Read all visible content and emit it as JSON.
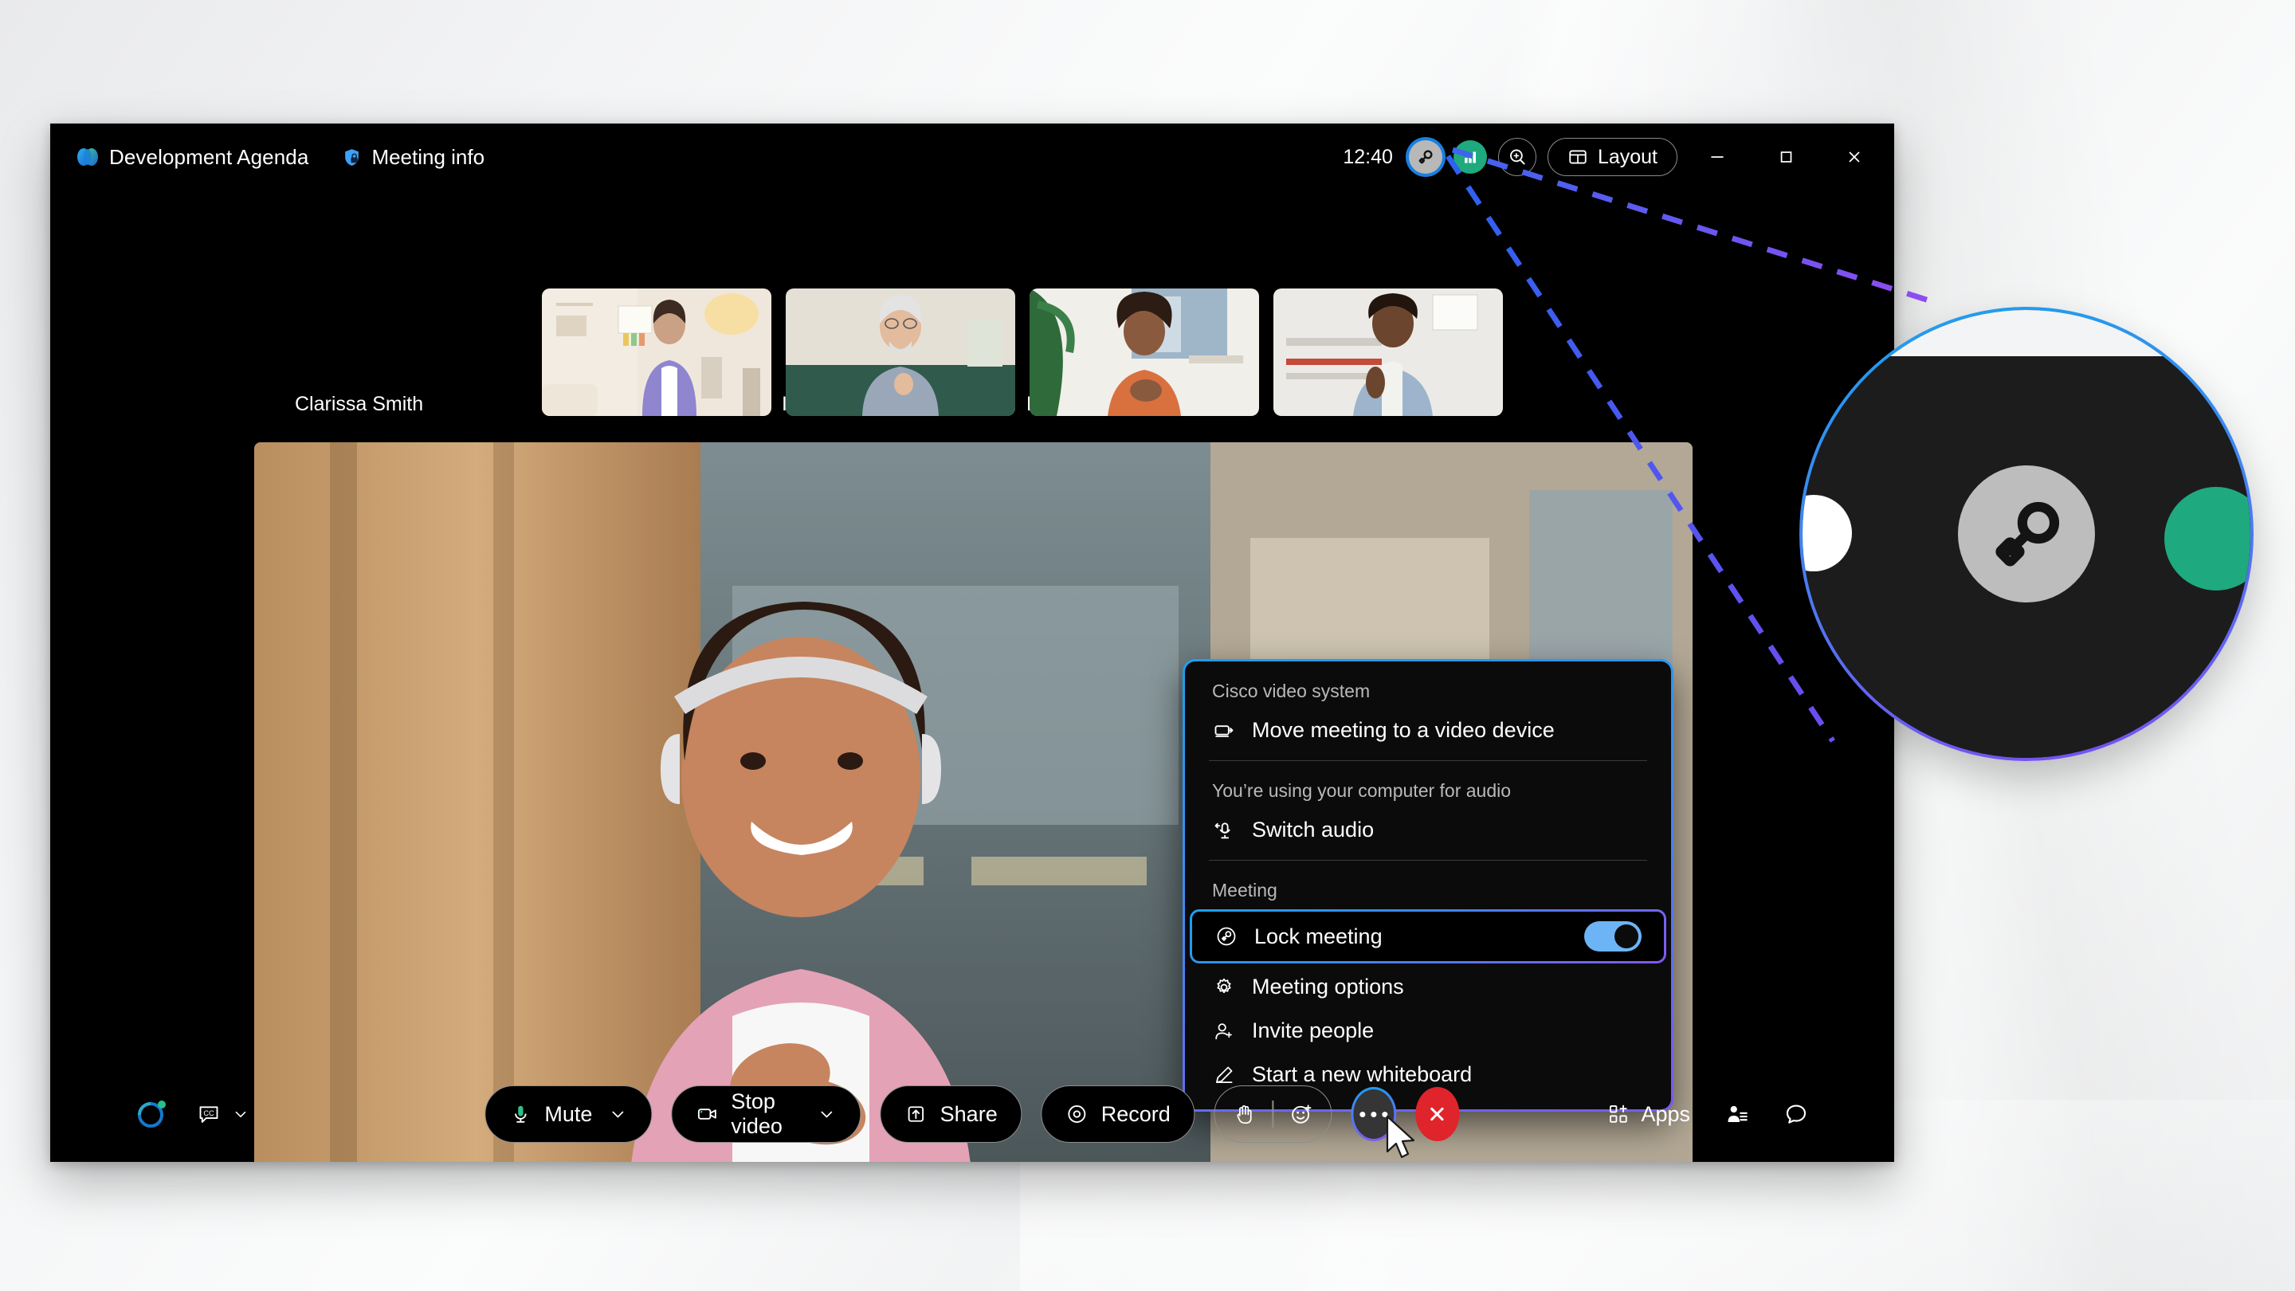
{
  "window": {
    "title": "Development Agenda",
    "meeting_info": "Meeting info",
    "clock": "12:40",
    "layout_button": "Layout",
    "icons": {
      "app_logo": "webex-logo",
      "meeting_info_icon": "shield-lock-icon",
      "lock_status_icon": "key-lock-icon",
      "network_status_icon": "signal-bars-icon",
      "zoom_icon": "magnifier-plus-icon",
      "layout_icon": "layout-grid-icon",
      "minimize_icon": "minimize-icon",
      "maximize_icon": "maximize-icon",
      "close_icon": "close-icon"
    }
  },
  "stage": {
    "self_name": "Clarissa Smith",
    "hidden_names": [
      "I",
      "D"
    ],
    "participant_count": 4
  },
  "menu": {
    "sections": [
      {
        "label": "Cisco video system",
        "items": [
          {
            "label": "Move meeting to a video device",
            "icon": "video-device-icon",
            "toggle": null
          }
        ]
      },
      {
        "label": "You’re using your computer for audio",
        "items": [
          {
            "label": "Switch audio",
            "icon": "switch-audio-icon",
            "toggle": null
          }
        ]
      },
      {
        "label": "Meeting",
        "items": [
          {
            "label": "Lock meeting",
            "icon": "key-lock-icon",
            "toggle": "on",
            "highlighted": true
          },
          {
            "label": "Meeting options",
            "icon": "gear-icon",
            "toggle": null
          },
          {
            "label": "Invite people",
            "icon": "add-person-icon",
            "toggle": null
          },
          {
            "label": "Start a new whiteboard",
            "icon": "pencil-icon",
            "toggle": null
          }
        ]
      }
    ]
  },
  "toolbar": {
    "captions_icon": "closed-captions-icon",
    "mute": {
      "label": "Mute",
      "icon": "microphone-icon"
    },
    "video": {
      "label": "Stop video",
      "icon": "camera-icon"
    },
    "share": {
      "label": "Share",
      "icon": "share-up-icon"
    },
    "record": {
      "label": "Record",
      "icon": "record-circle-icon"
    },
    "raise_hand_icon": "raise-hand-icon",
    "reactions_icon": "emoji-plus-icon",
    "more_icon": "more-options-icon",
    "leave_icon": "leave-meeting-icon",
    "apps": {
      "label": "Apps",
      "icon": "apps-grid-icon"
    },
    "participants_icon": "participants-icon",
    "chat_icon": "chat-bubble-icon"
  },
  "callout": {
    "magnified_icon": "key-lock-icon",
    "line_color_start": "#1ba0ef",
    "line_color_end": "#7b4cf0"
  },
  "colors": {
    "accent_blue": "#1ba0ef",
    "accent_purple": "#7b4cf0",
    "toggle_on": "#6db4f6",
    "leave_red": "#e0242b",
    "network_green": "#1fa97f",
    "mic_green": "#2dc08a",
    "window_bg": "#000000"
  }
}
